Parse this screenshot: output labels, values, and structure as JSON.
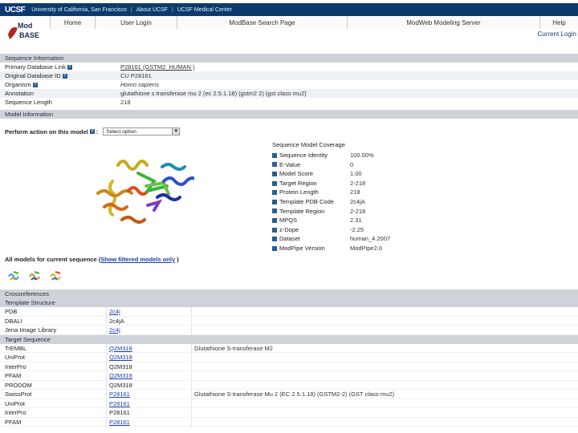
{
  "topbar": {
    "logo_main": "UCSF",
    "links": [
      "University of California, San Francisco",
      "About UCSF",
      "UCSF Medical Center"
    ],
    "seps": [
      "|",
      "|"
    ]
  },
  "nav": {
    "items": [
      "Home",
      "User Login",
      "ModBase Search Page",
      "ModWeb Modeling Server",
      "Help"
    ],
    "current_login": "Current Login"
  },
  "logo": {
    "line1": "Mod",
    "line2": "BASE"
  },
  "sequence_info": {
    "header": "Sequence Information",
    "rows": [
      {
        "label": "Primary Database Link",
        "value": "P28161 (GSTM2_HUMAN )"
      },
      {
        "label": "Original Database ID",
        "value": "CU P28161"
      },
      {
        "label": "Organism",
        "value": "Homo sapiens"
      },
      {
        "label": "Annotation",
        "value": "glutathione s transferase mu 2 (ec 2.5.1.18) (gstm2 2) (gst class mu2)"
      },
      {
        "label": "Sequence Length",
        "value": "218"
      }
    ]
  },
  "model_info": {
    "header": "Model Information",
    "action_label": "Perform action on this model",
    "select_value": "Select option"
  },
  "coverage": {
    "title": "Sequence Model Coverage",
    "items": [
      {
        "key": "Sequence Identity",
        "value": "100.00%"
      },
      {
        "key": "E-Value",
        "value": "0"
      },
      {
        "key": "Model Score",
        "value": "1.00"
      },
      {
        "key": "Target Region",
        "value": "2-218"
      },
      {
        "key": "Protein Length",
        "value": "218"
      },
      {
        "key": "Template PDB Code",
        "value": "2c4jA"
      },
      {
        "key": "Template Region",
        "value": "2-218"
      },
      {
        "key": "MPQS",
        "value": "2.31"
      },
      {
        "key": "z-Dope",
        "value": "-2.25"
      },
      {
        "key": "Dataset",
        "value": "human_4.2007"
      },
      {
        "key": "ModPipe Version",
        "value": "ModPipe2.0"
      }
    ]
  },
  "all_models": {
    "text": "All models for current sequence (",
    "link": "Show filtered models only",
    "close": " )"
  },
  "xrefs": {
    "header": "Crossreferences",
    "template_header": "Template Structure",
    "template_rows": [
      {
        "db": "PDB",
        "id": "2c4j",
        "desc": ""
      },
      {
        "db": "DBALI",
        "id": "2c4jA",
        "desc": ""
      },
      {
        "db": "Jena Image Library",
        "id": "2c4j",
        "desc": ""
      }
    ],
    "target_header": "Target Sequence",
    "target_rows": [
      {
        "db": "TrEMBL",
        "id": "Q2M318",
        "desc": "Glutathione S-transferase M2"
      },
      {
        "db": "UniProt",
        "id": "Q2M318",
        "desc": ""
      },
      {
        "db": "InterPro",
        "id": "Q2M318",
        "desc": ""
      },
      {
        "db": "PFAM",
        "id": "Q2M318",
        "desc": ""
      },
      {
        "db": "PRODOM",
        "id": "Q2M318",
        "desc": ""
      },
      {
        "db": "SwissProt",
        "id": "P28161",
        "desc": "Glutathione S-transferase Mu 2 (EC 2.5.1.18) (GSTM2-2) (GST class-mu2)"
      },
      {
        "db": "UniProt",
        "id": "P28161",
        "desc": ""
      },
      {
        "db": "InterPro",
        "id": "P28161",
        "desc": ""
      },
      {
        "db": "PFAM",
        "id": "P28161",
        "desc": ""
      }
    ]
  }
}
